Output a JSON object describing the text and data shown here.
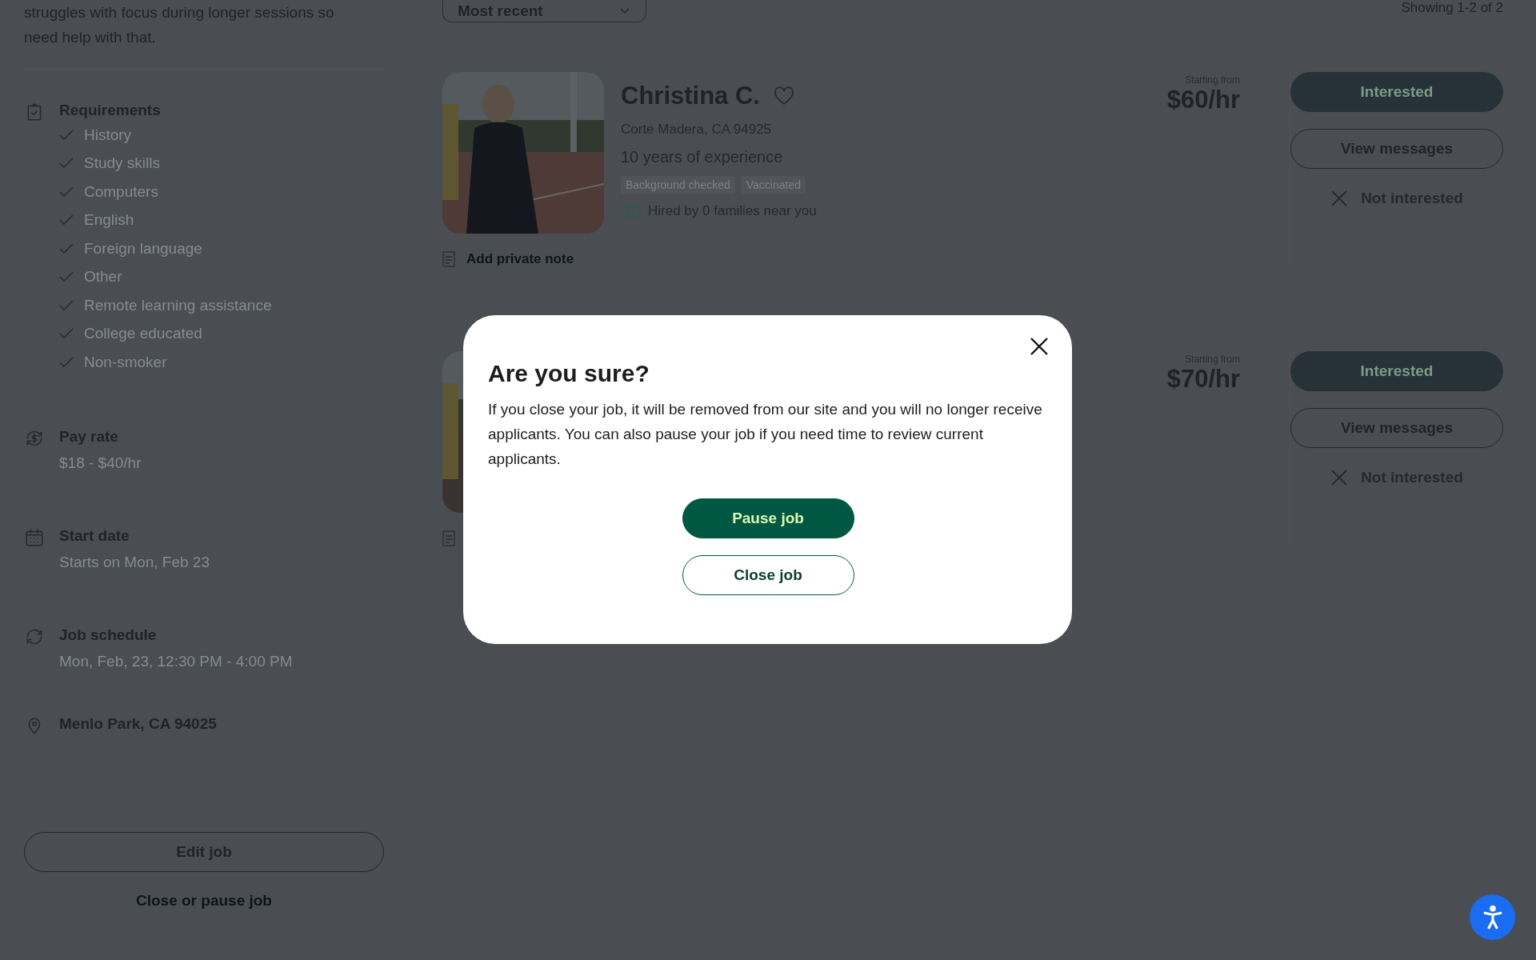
{
  "job": {
    "description_tail": [
      "struggles with focus during longer sessions so",
      "need help with that."
    ],
    "sections": [
      {
        "kind": "requirements",
        "title": "Requirements",
        "items": [
          "History",
          "Study skills",
          "Computers",
          "English",
          "Foreign language",
          "Other",
          "Remote learning assistance",
          "College educated",
          "Non-smoker"
        ]
      },
      {
        "kind": "pay_rate",
        "title": "Pay rate",
        "value": "$18 - $40/hr"
      },
      {
        "kind": "start_date",
        "title": "Start date",
        "value": "Starts on Mon, Feb 23"
      },
      {
        "kind": "schedule",
        "title": "Job schedule",
        "value": "Mon, Feb, 23, 12:30 PM - 4:00 PM"
      },
      {
        "kind": "location",
        "title": "Menlo Park, CA 94025"
      }
    ],
    "edit_button": "Edit job",
    "close_link": "Close or pause job"
  },
  "sort": {
    "value": "Most recent"
  },
  "showing": "Showing 1-2 of 2",
  "candidates": [
    {
      "name": "Christina C.",
      "location": "Corte Madera, CA 94925",
      "experience": "10 years of experience",
      "tags": [
        "Background checked",
        "Vaccinated"
      ],
      "hired": "Hired by 0 families near you",
      "note": "Add private note",
      "price_label": "Starting from",
      "price": "$60/hr",
      "actions": {
        "interested": "Interested",
        "messages": "View messages",
        "not_interested": "Not interested"
      }
    },
    {
      "price_label": "Starting from",
      "price": "$70/hr",
      "actions": {
        "interested": "Interested",
        "messages": "View messages",
        "not_interested": "Not interested"
      }
    }
  ],
  "dialog": {
    "title": "Are you sure?",
    "body": "If you close your job, it will be removed from our site and you will no longer receive applicants. You can also pause your job if you need time to review current applicants.",
    "primary": "Pause job",
    "secondary": "Close job"
  }
}
